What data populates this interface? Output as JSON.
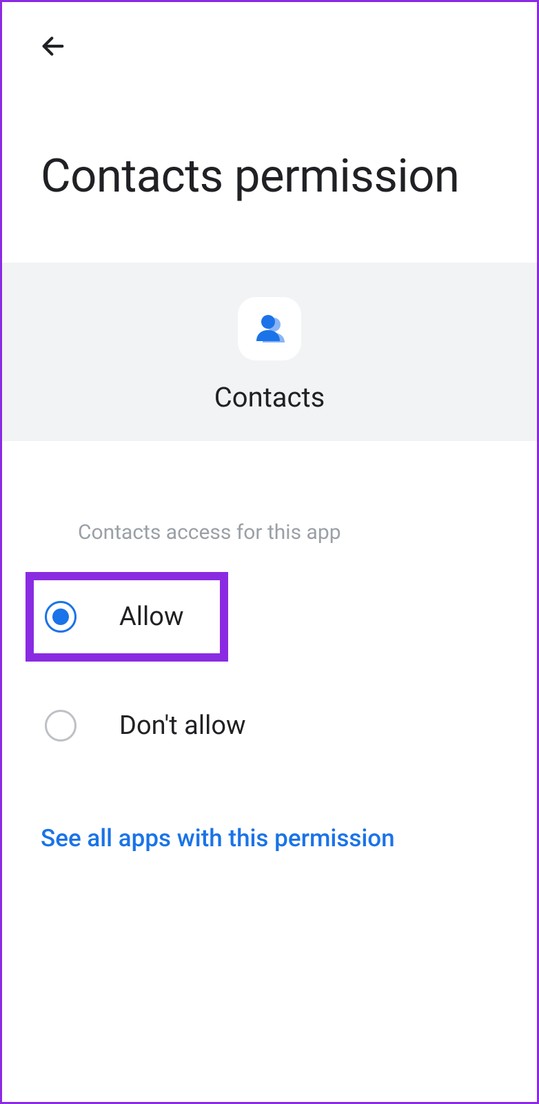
{
  "header": {
    "title": "Contacts permission"
  },
  "app": {
    "name": "Contacts"
  },
  "options": {
    "section_label": "Contacts access for this app",
    "allow_label": "Allow",
    "dont_allow_label": "Don't allow"
  },
  "link": {
    "see_all_label": "See all apps with this permission"
  }
}
